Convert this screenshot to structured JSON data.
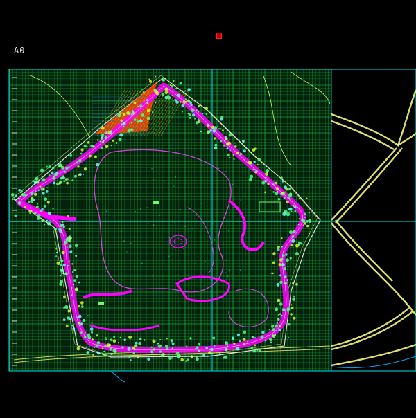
{
  "drawing": {
    "sheet_label": "A0",
    "background": "#000000",
    "colors": {
      "grid": "#00cc44",
      "frame": "#00e5e5",
      "path": "#ff00ff",
      "planting": "#55ff88",
      "hatch": "#ff4400",
      "road": "#e6e600",
      "road_outline": "#ffffff",
      "title_marker": "#ff2020"
    }
  }
}
